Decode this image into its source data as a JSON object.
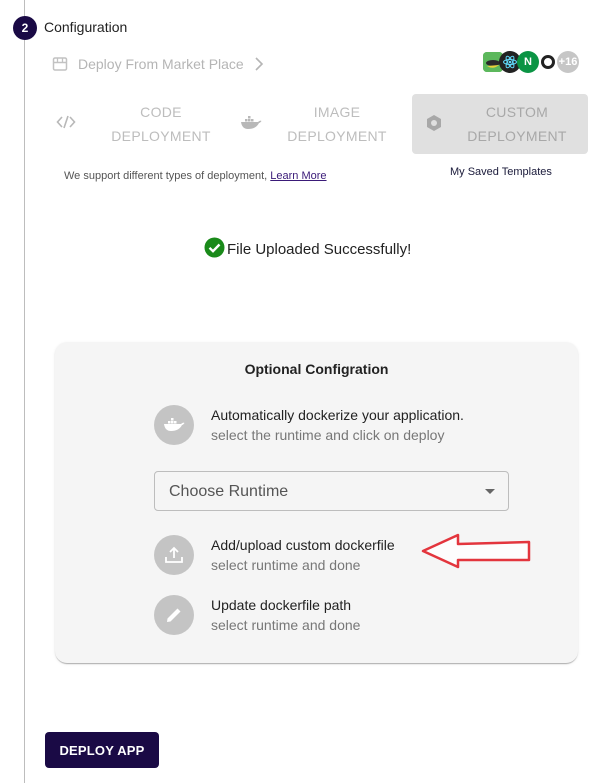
{
  "step": {
    "number": "2",
    "title": "Configuration"
  },
  "marketplace": {
    "label": "Deploy From Market Place",
    "icon": "storefront-icon",
    "chevron_icon": "chevron-right-icon"
  },
  "tech_icons": {
    "items": [
      "frog-icon",
      "react-icon",
      "nginx-icon",
      "circle-o-icon"
    ],
    "nginx_letter": "N",
    "more_count": "+16"
  },
  "deployment_tabs": [
    {
      "line1": "CODE",
      "line2": "DEPLOYMENT",
      "icon": "code-icon",
      "selected": false
    },
    {
      "line1": "IMAGE",
      "line2": "DEPLOYMENT",
      "icon": "docker-icon",
      "selected": false
    },
    {
      "line1": "CUSTOM",
      "line2": "DEPLOYMENT",
      "icon": "hexagon-icon",
      "selected": true
    }
  ],
  "support": {
    "text": "We support different types of deployment, ",
    "link": "Learn More"
  },
  "saved_templates": "My Saved Templates",
  "upload_status": {
    "text": "File Uploaded Successfully!",
    "color": "#1a8a1a"
  },
  "optional_config": {
    "title": "Optional Configration",
    "options": [
      {
        "main": "Automatically dockerize your application.",
        "sub": "select the runtime and click on deploy",
        "icon": "docker-icon"
      },
      {
        "main": "Add/upload custom dockerfile",
        "sub": "select runtime and done",
        "icon": "upload-icon"
      },
      {
        "main": "Update dockerfile path",
        "sub": "select runtime and done",
        "icon": "pencil-icon"
      }
    ],
    "runtime_select": {
      "value": "Choose Runtime"
    }
  },
  "annotation": {
    "type": "red-arrow",
    "color": "#e0141e"
  },
  "deploy_button": "DEPLOY APP",
  "colors": {
    "primary": "#1a0a45",
    "muted": "#bdbdbd",
    "card_bg": "#f5f5f5"
  }
}
